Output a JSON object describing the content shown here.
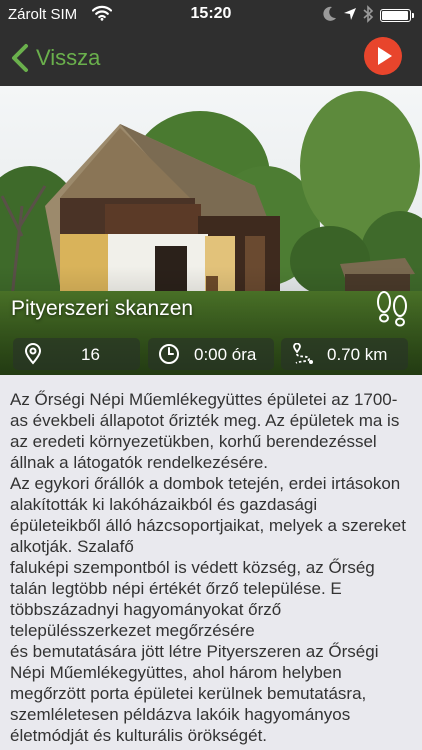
{
  "status_bar": {
    "carrier": "Zárolt SIM",
    "time": "15:20",
    "icons": [
      "wifi-icon",
      "moon-icon",
      "location-arrow-icon",
      "bluetooth-icon",
      "battery-icon"
    ]
  },
  "nav": {
    "back_label": "Vissza",
    "back_icon": "chevron-left-icon",
    "play_icon": "play-icon",
    "accent_color": "#6ab04c",
    "play_color": "#e8452c"
  },
  "tour": {
    "title": "Pityerszeri skanzen",
    "walk_icon": "footsteps-icon",
    "stats": {
      "stops": "16",
      "stops_icon": "map-pin-icon",
      "duration": "0:00 óra",
      "duration_icon": "clock-icon",
      "distance": "0.70 km",
      "distance_icon": "route-icon"
    }
  },
  "description": "Az Őrségi Népi Műemlékegyüttes épületei az 1700-as évekbeli állapotot őrizték meg. Az épületek ma is az eredeti környezetükben, korhű berendezéssel állnak a látogatók rendelkezésére.\nAz egykori őrállók a dombok tetején, erdei irtásokon alakították ki lakóházaikból és gazdasági épületeikből álló házcsoportjaikat, melyek a szereket alkotják. Szalafő\nfaluképi szempontból is védett község, az Őrség talán legtöbb népi értékét őrző települése. E többszázadnyi hagyományokat őrző településszerkezet megőrzésére\nés bemutatására jött létre Pityerszeren az Őrségi Népi Műemlékegyüttes, ahol három helyben megőrzött porta épületei kerülnek bemutatásra, szemléletesen példázva lakóik hagyományos életmódját és kulturális örökségét."
}
